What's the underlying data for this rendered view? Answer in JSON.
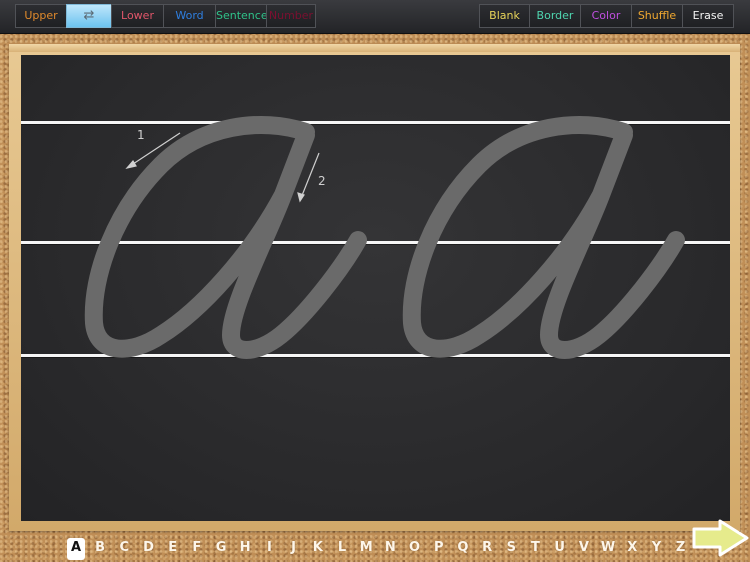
{
  "toolbar": {
    "left_buttons": [
      {
        "label": "Upper",
        "color": "#e08a2c"
      },
      {
        "label": "⇄",
        "icon": "swap-arrows-icon",
        "selected": true
      },
      {
        "label": "Lower",
        "color": "#e0566a"
      },
      {
        "label": "Word",
        "color": "#2f7fe0"
      },
      {
        "label": "Sentence",
        "color": "#2fc28a"
      },
      {
        "label": "Number",
        "color": "#7a1030"
      }
    ],
    "right_buttons": [
      {
        "label": "Blank",
        "color": "#e8d45a"
      },
      {
        "label": "Border",
        "color": "#4fd6b0"
      },
      {
        "label": "Color",
        "color": "#c04fe0"
      },
      {
        "label": "Shuffle",
        "color": "#f0a830"
      },
      {
        "label": "Erase",
        "color": "#f4f4f4"
      }
    ]
  },
  "board": {
    "letters": "a a",
    "trace_color": "#6a6a6a",
    "guide_color": "#f6f6f6",
    "stroke_hints": [
      {
        "number": "1"
      },
      {
        "number": "2"
      }
    ]
  },
  "alphabet": {
    "letters": [
      "A",
      "B",
      "C",
      "D",
      "E",
      "F",
      "G",
      "H",
      "I",
      "J",
      "K",
      "L",
      "M",
      "N",
      "O",
      "P",
      "Q",
      "R",
      "S",
      "T",
      "U",
      "V",
      "W",
      "X",
      "Y",
      "Z"
    ],
    "selected": "A"
  },
  "navigation": {
    "next_icon": "right-arrow-icon",
    "arrow_color": "#e6eb8c"
  }
}
